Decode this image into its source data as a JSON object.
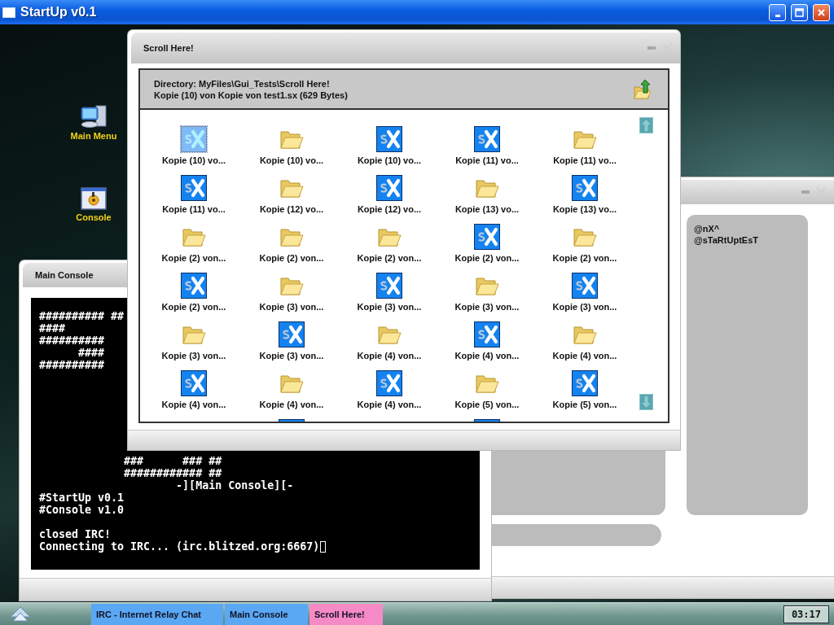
{
  "window": {
    "title": "StartUp v0.1"
  },
  "desktop_icons": [
    {
      "label": "Main Menu",
      "kind": "computer"
    },
    {
      "label": "Console",
      "kind": "console"
    }
  ],
  "irc_window": {
    "users": [
      "@nX^",
      "@sTaRtUptEsT"
    ]
  },
  "console_window": {
    "title": "Main Console",
    "banner": [
      "########## ##",
      "####",
      "##########",
      "      ####",
      "##########"
    ],
    "log_groups": [
      [
        "             ###      ### ##",
        "             ############ ##",
        "                     -][Main Console][-",
        "#StartUp v0.1",
        "#Console v1.0"
      ],
      [
        "closed IRC!",
        "Connecting to IRC... (irc.blitzed.org:6667)"
      ]
    ]
  },
  "scroll_window": {
    "title": "Scroll Here!",
    "directory": "Directory: MyFiles\\Gui_Tests\\Scroll Here!",
    "file_info": "Kopie (10) von Kopie von test1.sx (629 Bytes)",
    "files": [
      {
        "kind": "sx",
        "label": "Kopie (10) vo...",
        "selected": true
      },
      {
        "kind": "folder",
        "label": "Kopie (10) vo...",
        "selected": false
      },
      {
        "kind": "sx",
        "label": "Kopie (10) vo...",
        "selected": false
      },
      {
        "kind": "sx",
        "label": "Kopie (11) vo...",
        "selected": false
      },
      {
        "kind": "folder",
        "label": "Kopie (11) vo...",
        "selected": false
      },
      {
        "kind": "sx",
        "label": "Kopie (11) vo...",
        "selected": false
      },
      {
        "kind": "folder",
        "label": "Kopie (12) vo...",
        "selected": false
      },
      {
        "kind": "sx",
        "label": "Kopie (12) vo...",
        "selected": false
      },
      {
        "kind": "folder",
        "label": "Kopie (13) vo...",
        "selected": false
      },
      {
        "kind": "sx",
        "label": "Kopie (13) vo...",
        "selected": false
      },
      {
        "kind": "folder",
        "label": "Kopie (2) von...",
        "selected": false
      },
      {
        "kind": "folder",
        "label": "Kopie (2) von...",
        "selected": false
      },
      {
        "kind": "folder",
        "label": "Kopie (2) von...",
        "selected": false
      },
      {
        "kind": "sx",
        "label": "Kopie (2) von...",
        "selected": false
      },
      {
        "kind": "folder",
        "label": "Kopie (2) von...",
        "selected": false
      },
      {
        "kind": "sx",
        "label": "Kopie (2) von...",
        "selected": false
      },
      {
        "kind": "folder",
        "label": "Kopie (3) von...",
        "selected": false
      },
      {
        "kind": "sx",
        "label": "Kopie (3) von...",
        "selected": false
      },
      {
        "kind": "folder",
        "label": "Kopie (3) von...",
        "selected": false
      },
      {
        "kind": "sx",
        "label": "Kopie (3) von...",
        "selected": false
      },
      {
        "kind": "folder",
        "label": "Kopie (3) von...",
        "selected": false
      },
      {
        "kind": "sx",
        "label": "Kopie (3) von...",
        "selected": false
      },
      {
        "kind": "folder",
        "label": "Kopie (4) von...",
        "selected": false
      },
      {
        "kind": "sx",
        "label": "Kopie (4) von...",
        "selected": false
      },
      {
        "kind": "folder",
        "label": "Kopie (4) von...",
        "selected": false
      },
      {
        "kind": "sx",
        "label": "Kopie (4) von...",
        "selected": false
      },
      {
        "kind": "folder",
        "label": "Kopie (4) von...",
        "selected": false
      },
      {
        "kind": "sx",
        "label": "Kopie (4) von...",
        "selected": false
      },
      {
        "kind": "folder",
        "label": "Kopie (5) von...",
        "selected": false
      },
      {
        "kind": "sx",
        "label": "Kopie (5) von...",
        "selected": false
      },
      {
        "kind": "blank",
        "selected": false
      },
      {
        "kind": "sx",
        "selected": false
      },
      {
        "kind": "blank",
        "selected": false
      },
      {
        "kind": "sx",
        "selected": false
      },
      {
        "kind": "blank",
        "selected": false
      }
    ]
  },
  "taskbar": {
    "tasks": [
      {
        "label": "IRC - Internet Relay Chat",
        "selected": false
      },
      {
        "label": "Main Console",
        "selected": false
      },
      {
        "label": "Scroll Here!",
        "selected": true
      }
    ],
    "clock": "03:17"
  }
}
